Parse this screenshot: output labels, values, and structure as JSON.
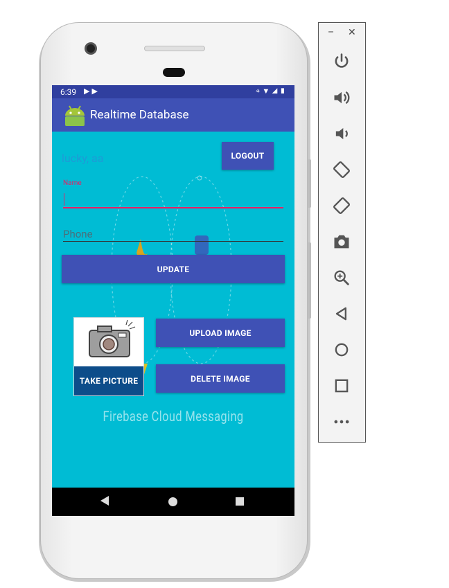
{
  "status_bar": {
    "time": "6:39",
    "left_icons": [
      "play-store-icon",
      "play-store-icon"
    ],
    "right_icons": [
      "location-icon",
      "wifi-icon",
      "signal-icon",
      "battery-icon"
    ]
  },
  "app_bar": {
    "icon": "android-icon",
    "title": "Realtime Database"
  },
  "main": {
    "user_text": "lucky, aa",
    "logout_label": "LOGOUT",
    "name_field": {
      "floating_label": "Name",
      "value": ""
    },
    "phone_field": {
      "placeholder": "Phone",
      "value": ""
    },
    "update_label": "UPDATE",
    "take_picture_label": "TAKE PICTURE",
    "upload_label": "UPLOAD IMAGE",
    "delete_label": "DELETE IMAGE",
    "footer_text": "Firebase Cloud Messaging"
  },
  "nav_bar": {
    "items": [
      "back-icon",
      "home-icon",
      "recents-icon"
    ]
  },
  "emulator_toolbar": {
    "window_controls": [
      "minimize-icon",
      "close-icon"
    ],
    "minimize_glyph": "–",
    "close_glyph": "✕",
    "buttons": [
      "power-icon",
      "volume-up-icon",
      "volume-down-icon",
      "rotate-left-icon",
      "rotate-right-icon",
      "screenshot-icon",
      "zoom-icon",
      "back-icon",
      "home-icon",
      "overview-icon",
      "more-icon"
    ]
  },
  "colors": {
    "primary": "#3f51b5",
    "primary_dark": "#303f9f",
    "background": "#00bcd4",
    "accent": "#e91e63"
  }
}
